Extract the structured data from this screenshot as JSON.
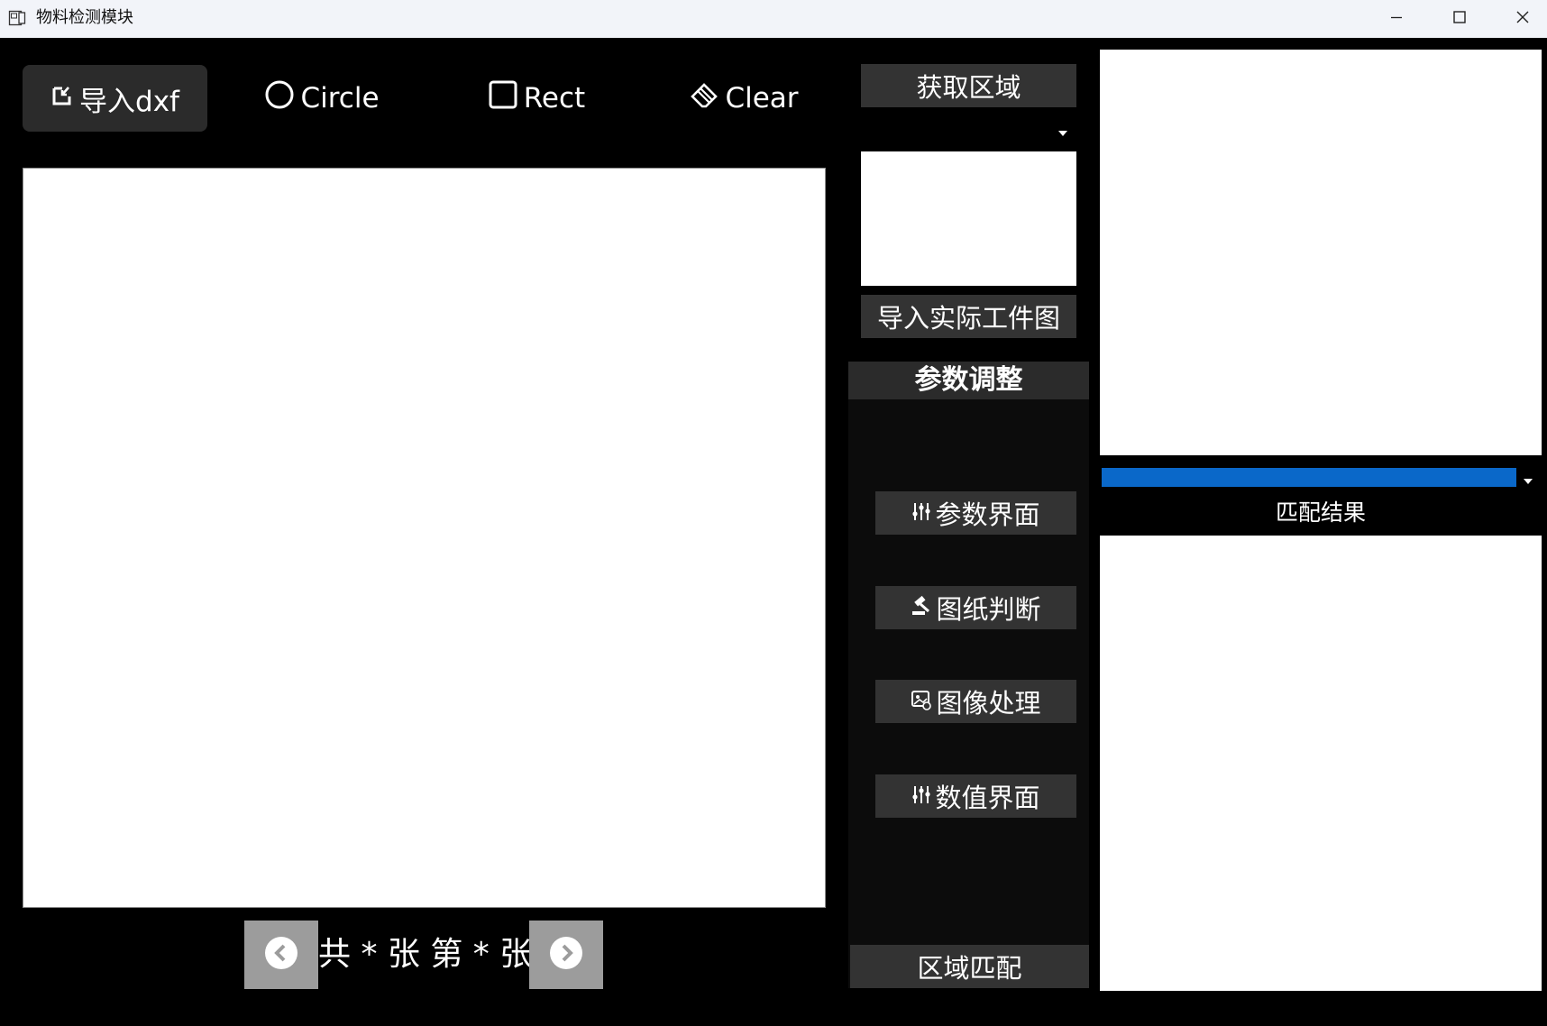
{
  "window": {
    "title": "物料检测模块",
    "app_icon": "document-image-icon",
    "controls": [
      "minimize-icon",
      "maximize-icon",
      "close-icon"
    ]
  },
  "toolbar": {
    "import_dxf": {
      "label": "导入dxf",
      "icon": "import-icon"
    },
    "circle": {
      "label": "Circle",
      "icon": "circle-icon"
    },
    "rect": {
      "label": "Rect",
      "icon": "rect-icon"
    },
    "clear": {
      "label": "Clear",
      "icon": "eraser-icon"
    }
  },
  "pager": {
    "text": "共 * 张 第 * 张",
    "prev_icon": "chevron-left-circle-icon",
    "next_icon": "chevron-right-circle-icon"
  },
  "middle": {
    "get_region_label": "获取区域",
    "import_actual_label": "导入实际工件图",
    "param_header": "参数调整",
    "buttons": [
      {
        "label": "参数界面",
        "icon": "sliders-icon"
      },
      {
        "label": "图纸判断",
        "icon": "gavel-icon"
      },
      {
        "label": "图像处理",
        "icon": "image-process-icon"
      },
      {
        "label": "数值界面",
        "icon": "sliders-icon"
      }
    ],
    "region_match_label": "区域匹配"
  },
  "right": {
    "match_result_label": "匹配结果",
    "accent_color": "#0a68c9"
  }
}
